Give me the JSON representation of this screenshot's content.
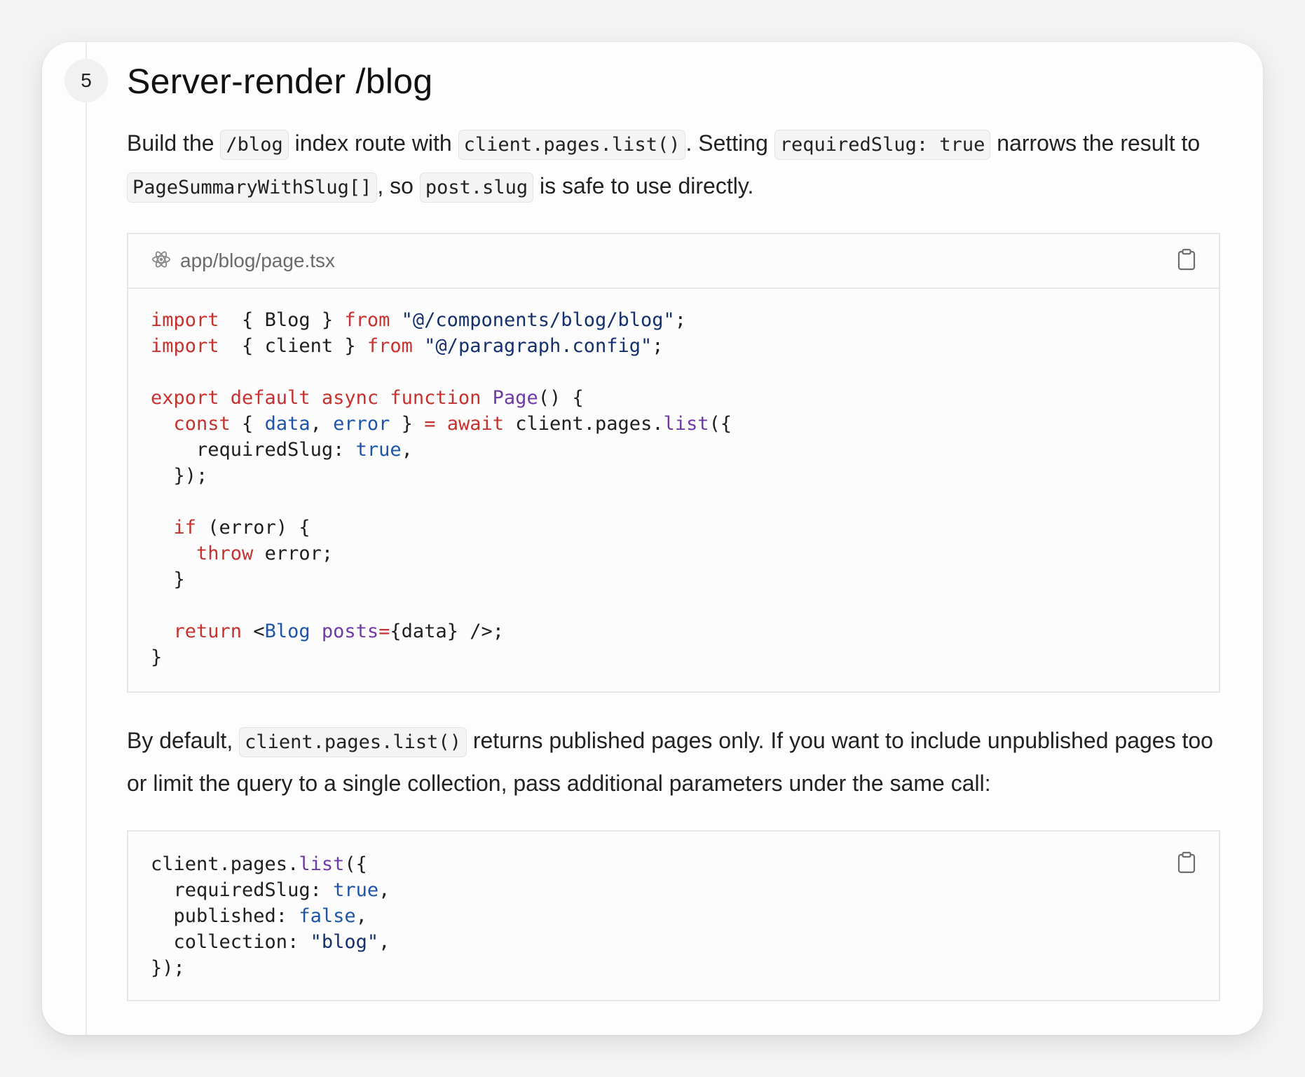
{
  "step": {
    "number": "5",
    "title": "Server-render /blog"
  },
  "intro": {
    "t1": "Build the ",
    "c1": "/blog",
    "t2": " index route with ",
    "c2": "client.pages.list()",
    "t3": ". Setting ",
    "c3": "requiredSlug: true",
    "t4": " narrows the result to ",
    "c4": "PageSummaryWithSlug[]",
    "t5": ", so ",
    "c5": "post.slug",
    "t6": " is safe to use directly."
  },
  "code_block_1": {
    "filename": "app/blog/page.tsx",
    "file_icon": "react-icon",
    "copy_icon": "clipboard-icon",
    "lines": [
      [
        [
          "kw",
          "import"
        ],
        [
          "",
          "  { Blog } "
        ],
        [
          "kw",
          "from"
        ],
        [
          "",
          " "
        ],
        [
          "str",
          "\"@/components/blog/blog\""
        ],
        [
          "",
          ";"
        ]
      ],
      [
        [
          "kw",
          "import"
        ],
        [
          "",
          "  { client } "
        ],
        [
          "kw",
          "from"
        ],
        [
          "",
          " "
        ],
        [
          "str",
          "\"@/paragraph.config\""
        ],
        [
          "",
          ";"
        ]
      ],
      [],
      [
        [
          "kw",
          "export default async function"
        ],
        [
          "",
          " "
        ],
        [
          "fn",
          "Page"
        ],
        [
          "",
          "() {"
        ]
      ],
      [
        [
          "",
          "  "
        ],
        [
          "kw",
          "const"
        ],
        [
          "",
          " { "
        ],
        [
          "bl",
          "data"
        ],
        [
          "",
          ", "
        ],
        [
          "bl",
          "error"
        ],
        [
          "",
          " } "
        ],
        [
          "kw",
          "="
        ],
        [
          "",
          " "
        ],
        [
          "kw",
          "await"
        ],
        [
          "",
          " client.pages."
        ],
        [
          "fn",
          "list"
        ],
        [
          "",
          "({"
        ]
      ],
      [
        [
          "",
          "    requiredSlug: "
        ],
        [
          "bl",
          "true"
        ],
        [
          "",
          ","
        ]
      ],
      [
        [
          "",
          "  });"
        ]
      ],
      [],
      [
        [
          "",
          "  "
        ],
        [
          "kw",
          "if"
        ],
        [
          "",
          " (error) {"
        ]
      ],
      [
        [
          "",
          "    "
        ],
        [
          "kw",
          "throw"
        ],
        [
          "",
          " error;"
        ]
      ],
      [
        [
          "",
          "  }"
        ]
      ],
      [],
      [
        [
          "",
          "  "
        ],
        [
          "kw",
          "return"
        ],
        [
          "",
          " <"
        ],
        [
          "tag",
          "Blog"
        ],
        [
          "",
          " "
        ],
        [
          "attr",
          "posts"
        ],
        [
          "kw",
          "="
        ],
        [
          "",
          "{data} />;"
        ]
      ],
      [
        [
          "",
          "}"
        ]
      ]
    ]
  },
  "outro": {
    "t1": "By default, ",
    "c1": "client.pages.list()",
    "t2": " returns published pages only. If you want to include unpublished pages too or limit the query to a single collection, pass additional parameters under the same call:"
  },
  "code_block_2": {
    "copy_icon": "clipboard-icon",
    "lines": [
      [
        [
          "",
          "client.pages."
        ],
        [
          "fn",
          "list"
        ],
        [
          "",
          "({"
        ]
      ],
      [
        [
          "",
          "  requiredSlug: "
        ],
        [
          "bl",
          "true"
        ],
        [
          "",
          ","
        ]
      ],
      [
        [
          "",
          "  published: "
        ],
        [
          "bl",
          "false"
        ],
        [
          "",
          ","
        ]
      ],
      [
        [
          "",
          "  collection: "
        ],
        [
          "str",
          "\"blog\""
        ],
        [
          "",
          ","
        ]
      ],
      [
        [
          "",
          "});"
        ]
      ]
    ]
  }
}
